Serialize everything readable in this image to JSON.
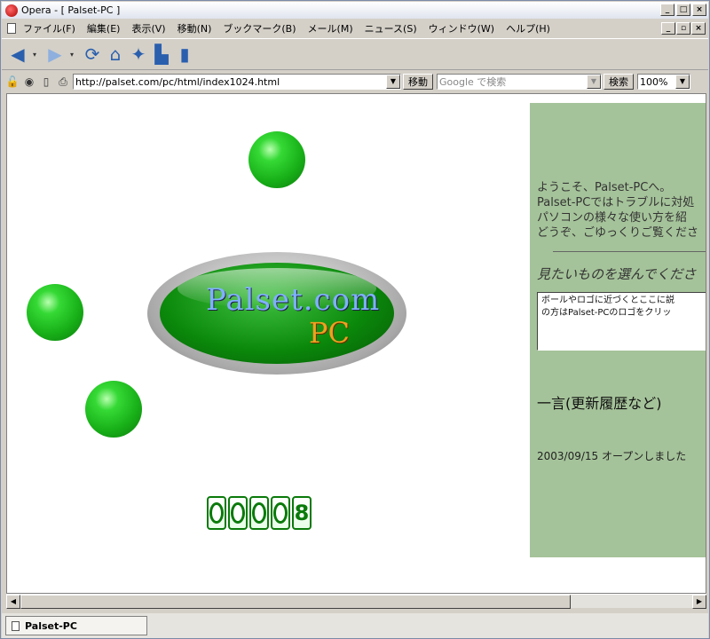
{
  "window": {
    "title": "Opera - [ Palset-PC ]"
  },
  "menu": {
    "items": [
      "ファイル(F)",
      "編集(E)",
      "表示(V)",
      "移動(N)",
      "ブックマーク(B)",
      "メール(M)",
      "ニュース(S)",
      "ウィンドウ(W)",
      "ヘルプ(H)"
    ]
  },
  "toolbar": {
    "icons": [
      "back-icon",
      "forward-icon",
      "reload-icon",
      "home-icon",
      "hotlist-icon",
      "print-icon",
      "note-icon"
    ]
  },
  "address": {
    "url": "http://palset.com/pc/html/index1024.html",
    "go_label": "移動"
  },
  "search": {
    "placeholder": "Google で検索",
    "button_label": "検索"
  },
  "zoom": {
    "value": "100%"
  },
  "page": {
    "logo_line1": "Palset.com",
    "logo_line2": "PC",
    "counter": [
      "0",
      "0",
      "0",
      "0",
      "8"
    ],
    "welcome": [
      "ようこそ、Palset-PCへ。",
      "Palset-PCではトラブルに対処",
      "パソコンの様々な使い方を紹",
      "どうぞ、ごゆっくりご覧くださ"
    ],
    "choose_heading": "見たいものを選んでくださ",
    "info_text": [
      "ボールやロゴに近づくとここに説",
      "の方はPalset-PCのロゴをクリッ"
    ],
    "history_heading": "一言(更新履歴など)",
    "history_entry": "2003/09/15 オープンしました"
  },
  "status": {
    "tab_label": "Palset-PC"
  },
  "colors": {
    "sidebar": "#a5c39a",
    "ball": "#18b018"
  }
}
